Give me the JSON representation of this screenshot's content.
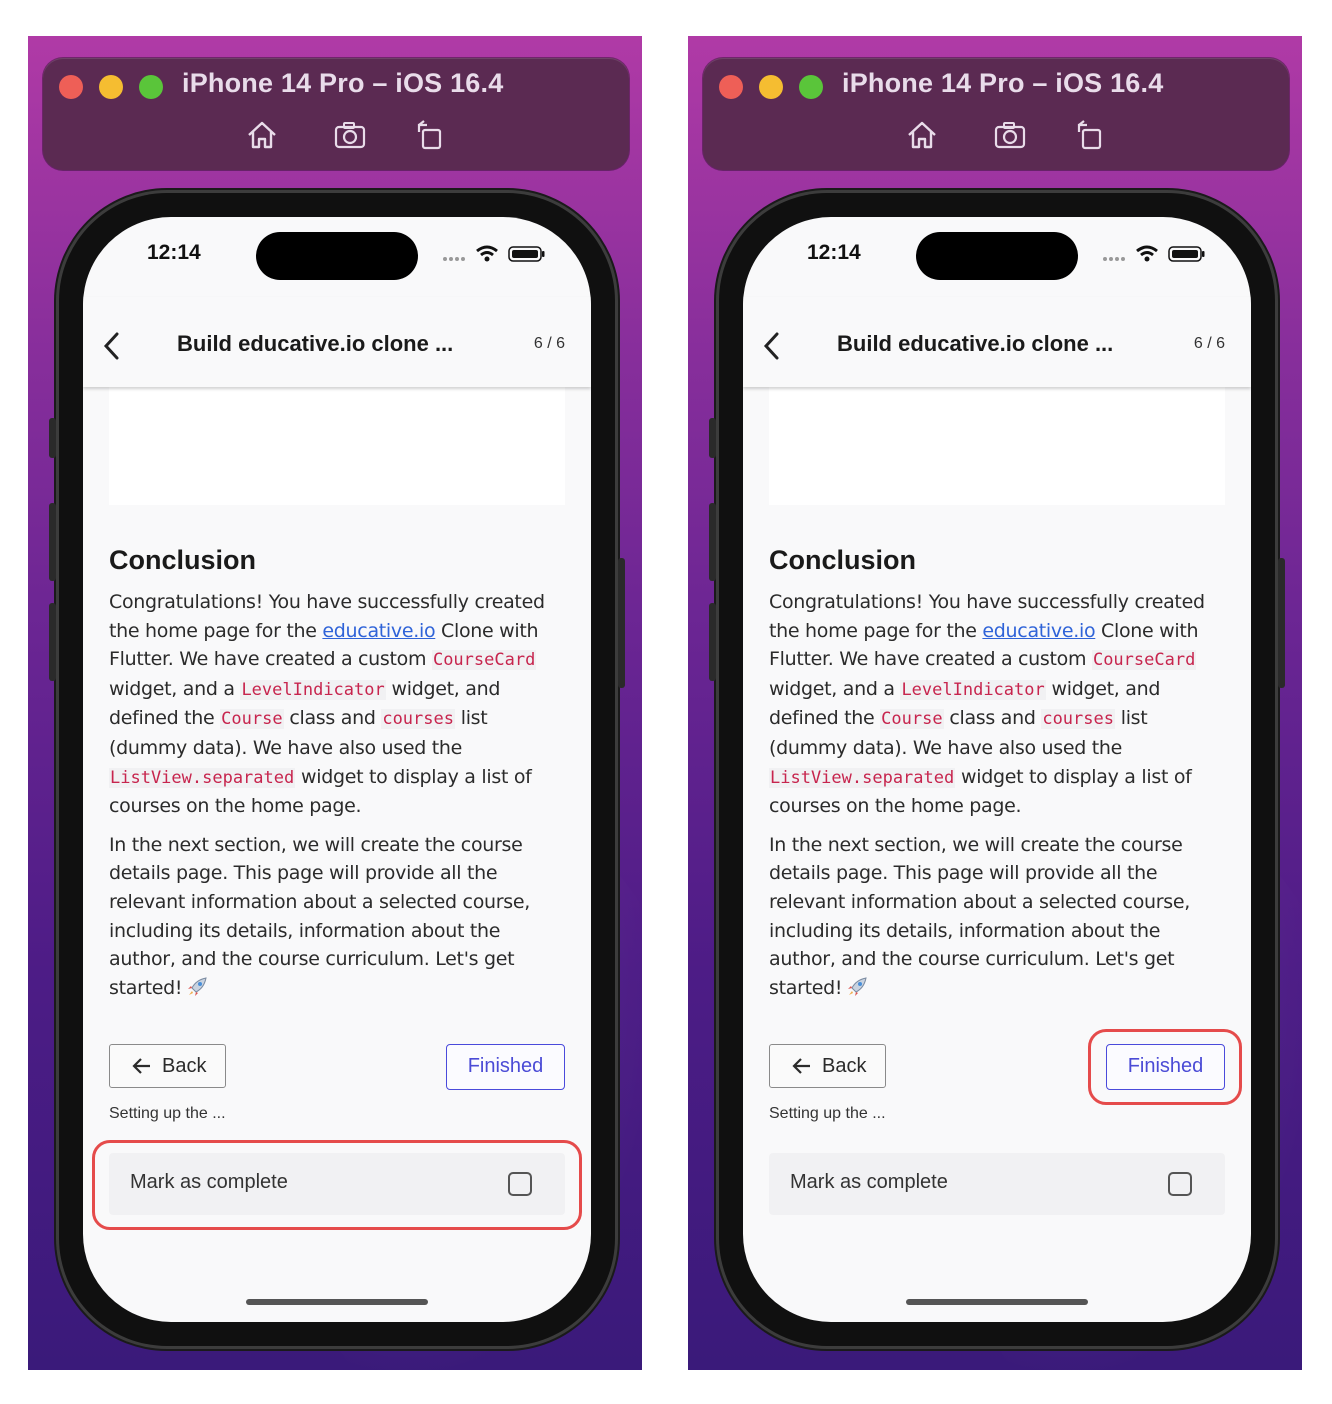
{
  "window_title": "iPhone 14 Pro – iOS 16.4",
  "status": {
    "time": "12:14"
  },
  "nav": {
    "title": "Build educative.io clone ...",
    "count": "6 / 6"
  },
  "lesson": {
    "heading": "Conclusion",
    "p1": {
      "t1": "Congratulations! You have successfully created the home page for the ",
      "link": "educative.io",
      "t2": " Clone with Flutter. We have created a custom ",
      "c1": "CourseCard",
      "t3": " widget, and a ",
      "c2": "LevelIndicator",
      "t4": " widget, and defined the ",
      "c3": "Course",
      "t5": " class and ",
      "c4": "courses",
      "t6": " list (dummy data). We have also used the ",
      "c5": "ListView.separated",
      "t7": " widget to display a list of courses on the home page."
    },
    "p2": "In the next section, we will create the course details page. This page will provide all the relevant information about a selected course, including its details, information about the author, and the course curriculum. Let's get started!"
  },
  "buttons": {
    "back": "Back",
    "finished": "Finished"
  },
  "prev_lesson": "Setting up the ...",
  "mark_complete": {
    "label": "Mark as complete",
    "checked": false
  },
  "icons": [
    "home-icon",
    "screenshot-icon",
    "rotate-icon",
    "chevron-left-icon",
    "wifi-icon",
    "battery-icon",
    "signal-icon",
    "arrow-left-icon",
    "rocket-icon",
    "checkbox-icon"
  ],
  "colors": {
    "highlight": "#e54b4b",
    "link": "#2f63d8",
    "code": "#c7254e",
    "finished": "#4b4bd6"
  },
  "highlights": {
    "left_panel": "mark-as-complete-row",
    "right_panel": "finished-button"
  }
}
